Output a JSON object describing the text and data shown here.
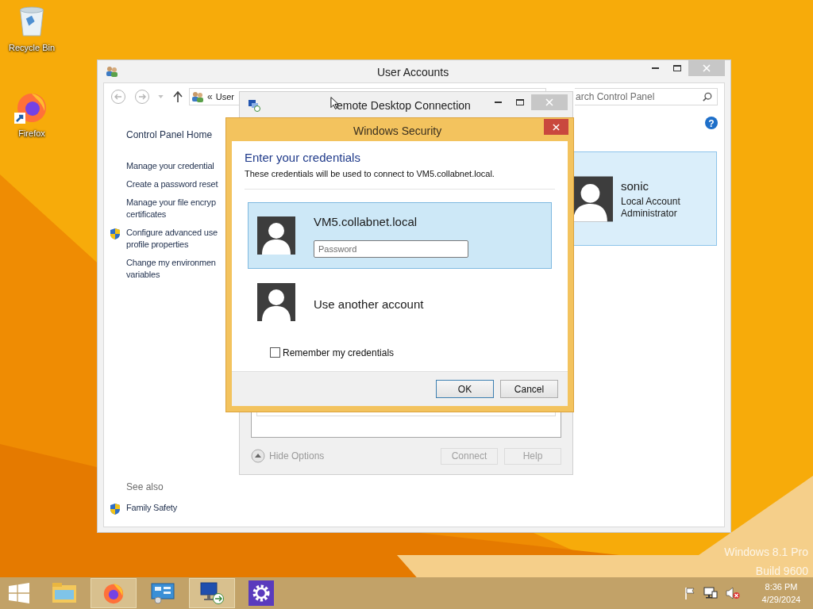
{
  "desktop_icons": [
    {
      "label": "Recycle Bin",
      "kind": "recycle-bin"
    },
    {
      "label": "Firefox",
      "kind": "firefox"
    }
  ],
  "user_accounts_window": {
    "title": "User Accounts",
    "breadcrumb_chevron": "«",
    "address": "User",
    "search_placeholder": "arch Control Panel",
    "nav_home": "Control Panel Home",
    "tasks": [
      {
        "lines": [
          "Manage your credential"
        ],
        "kind": "link"
      },
      {
        "lines": [
          "Create a password reset"
        ],
        "kind": "link"
      },
      {
        "lines": [
          "Manage your file encryp",
          "certificates"
        ],
        "kind": "link"
      },
      {
        "lines": [
          "Configure advanced use",
          "profile properties"
        ],
        "kind": "shield"
      },
      {
        "lines": [
          "Change my environmen",
          "variables"
        ],
        "kind": "link"
      }
    ],
    "see_also_heading": "See also",
    "see_also": [
      {
        "lines": [
          "Family Safety"
        ],
        "kind": "shield"
      }
    ],
    "help_label": "?",
    "account": {
      "name": "sonic",
      "details": [
        "Local Account",
        "Administrator"
      ]
    }
  },
  "rdc_window": {
    "title": "emote Desktop Connection",
    "hide_options": "Hide Options",
    "buttons": [
      {
        "label": "Connect",
        "disabled": true
      },
      {
        "label": "Help",
        "disabled": true
      }
    ]
  },
  "security_dialog": {
    "title": "Windows Security",
    "heading": "Enter your credentials",
    "description": "These credentials will be used to connect to VM5.collabnet.local.",
    "tiles": [
      {
        "label": "VM5.collabnet.local",
        "selected": true,
        "kind": "password",
        "placeholder": "Password"
      },
      {
        "label": "Use another account",
        "selected": false,
        "kind": "plain"
      }
    ],
    "remember": {
      "label": "Remember my credentials",
      "checked": false
    },
    "buttons": [
      {
        "label": "OK",
        "default": true
      },
      {
        "label": "Cancel",
        "default": false
      }
    ]
  },
  "os_watermark": [
    "Windows 8.1 Pro",
    "Build 9600"
  ],
  "taskbar": {
    "apps": [
      {
        "kind": "file-explorer",
        "selected": false
      },
      {
        "kind": "firefox",
        "selected": true
      },
      {
        "kind": "control-panel",
        "selected": false
      },
      {
        "kind": "remote-desktop",
        "selected": true
      },
      {
        "kind": "settings",
        "selected": false
      }
    ],
    "time": "8:36 PM",
    "date": "4/29/2024"
  }
}
